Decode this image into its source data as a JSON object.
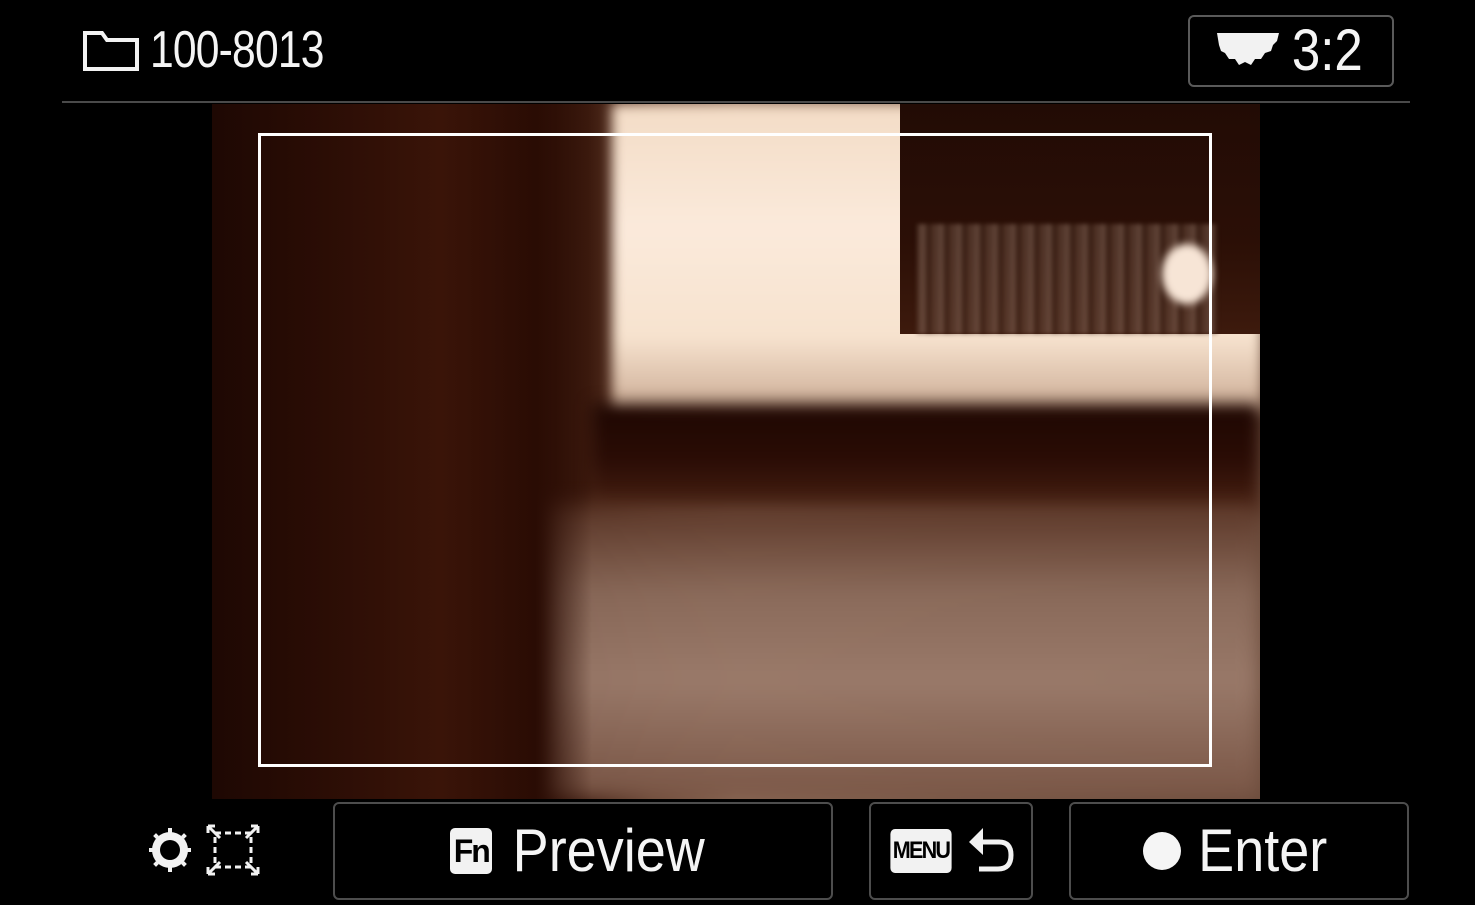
{
  "header": {
    "folder_icon": "folder-icon",
    "folder_number": "100-8013",
    "aspect_icon": "aspect-ratio-stamp-icon",
    "aspect_ratio": "3:2"
  },
  "preview": {
    "image": "photo-preview-sepia",
    "crop_frame_color": "#ffffff"
  },
  "footer": {
    "left_icons": [
      "control-wheel-icon",
      "crop-frame-icon"
    ],
    "preview_button": {
      "key": "Fn",
      "label": "Preview"
    },
    "back_button": {
      "key": "MENU",
      "icon": "back-arrow-icon"
    },
    "enter_button": {
      "icon": "center-button-dot-icon",
      "label": "Enter"
    }
  },
  "colors": {
    "background": "#000000",
    "text": "#f5f5f5",
    "border": "#4d4d4d"
  }
}
